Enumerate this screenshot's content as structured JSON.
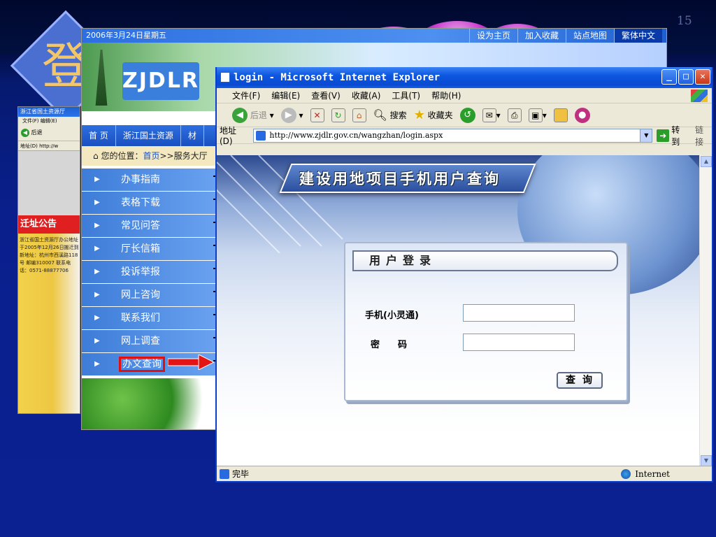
{
  "slide": {
    "number": "15",
    "big_char": "登"
  },
  "back_window": {
    "title": "浙江省国土资源厅",
    "menu": "文件(F)  编辑(E)",
    "back_label": "后退",
    "address_prefix": "地址(D)",
    "address_value": "http://w",
    "notice_title": "迁址公告",
    "notice_text": "浙江省国土资源厅办公地址于2005年12月26日搬迁到新地址：杭州市西溪路118号 邮编310007 联系电话：0571-88877706"
  },
  "site": {
    "date": "2006年3月24日星期五",
    "top_links": [
      "设为主页",
      "加入收藏",
      "站点地图",
      "繁体中文"
    ],
    "logo": "ZJDLR",
    "title_partial": "浙江省国土资源厅",
    "nav": [
      "首 页",
      "浙江国土资源",
      "材"
    ],
    "breadcrumb_prefix": "您的位置：",
    "breadcrumb_link": "首页",
    "breadcrumb_rest": ">>服务大厅",
    "menu": [
      "办事指南",
      "表格下载",
      "常见问答",
      "厅长信箱",
      "投诉举报",
      "网上咨询",
      "联系我们",
      "网上调查",
      "办文查询"
    ]
  },
  "ie": {
    "title": "login - Microsoft Internet Explorer",
    "menu": [
      "文件(F)",
      "编辑(E)",
      "查看(V)",
      "收藏(A)",
      "工具(T)",
      "帮助(H)"
    ],
    "toolbar": {
      "back": "后退",
      "search": "搜索",
      "favorites": "收藏夹"
    },
    "address_label": "地址(D)",
    "address": "http://www.zjdlr.gov.cn/wangzhan/login.aspx",
    "go": "转到",
    "links": "链接",
    "status": "完毕",
    "zone": "Internet"
  },
  "page": {
    "banner": "建设用地项目手机用户查询",
    "login_title": "用户登录",
    "phone_label": "手机(小灵通)",
    "password_label": "密　　码",
    "query_button": "查询"
  }
}
